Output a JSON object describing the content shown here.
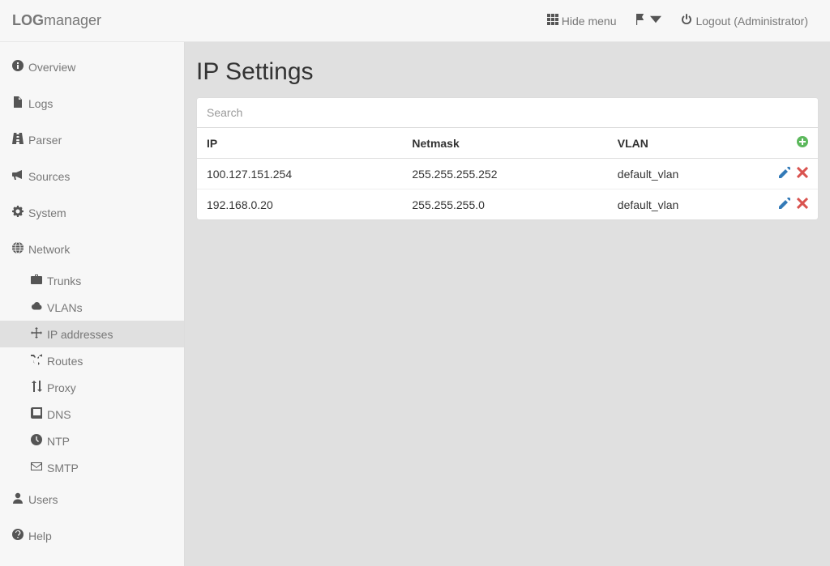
{
  "header": {
    "brand_prefix": "LOG",
    "brand_suffix": "manager",
    "hide_menu": "Hide menu",
    "logout_label": "Logout (Administrator)"
  },
  "sidebar": {
    "overview": "Overview",
    "logs": "Logs",
    "parser": "Parser",
    "sources": "Sources",
    "system": "System",
    "network": "Network",
    "network_sub": {
      "trunks": "Trunks",
      "vlans": "VLANs",
      "ip_addresses": "IP addresses",
      "routes": "Routes",
      "proxy": "Proxy",
      "dns": "DNS",
      "ntp": "NTP",
      "smtp": "SMTP"
    },
    "users": "Users",
    "help": "Help"
  },
  "main": {
    "title": "IP Settings",
    "search_placeholder": "Search",
    "columns": {
      "ip": "IP",
      "netmask": "Netmask",
      "vlan": "VLAN"
    },
    "rows": [
      {
        "ip": "100.127.151.254",
        "netmask": "255.255.255.252",
        "vlan": "default_vlan"
      },
      {
        "ip": "192.168.0.20",
        "netmask": "255.255.255.0",
        "vlan": "default_vlan"
      }
    ]
  }
}
